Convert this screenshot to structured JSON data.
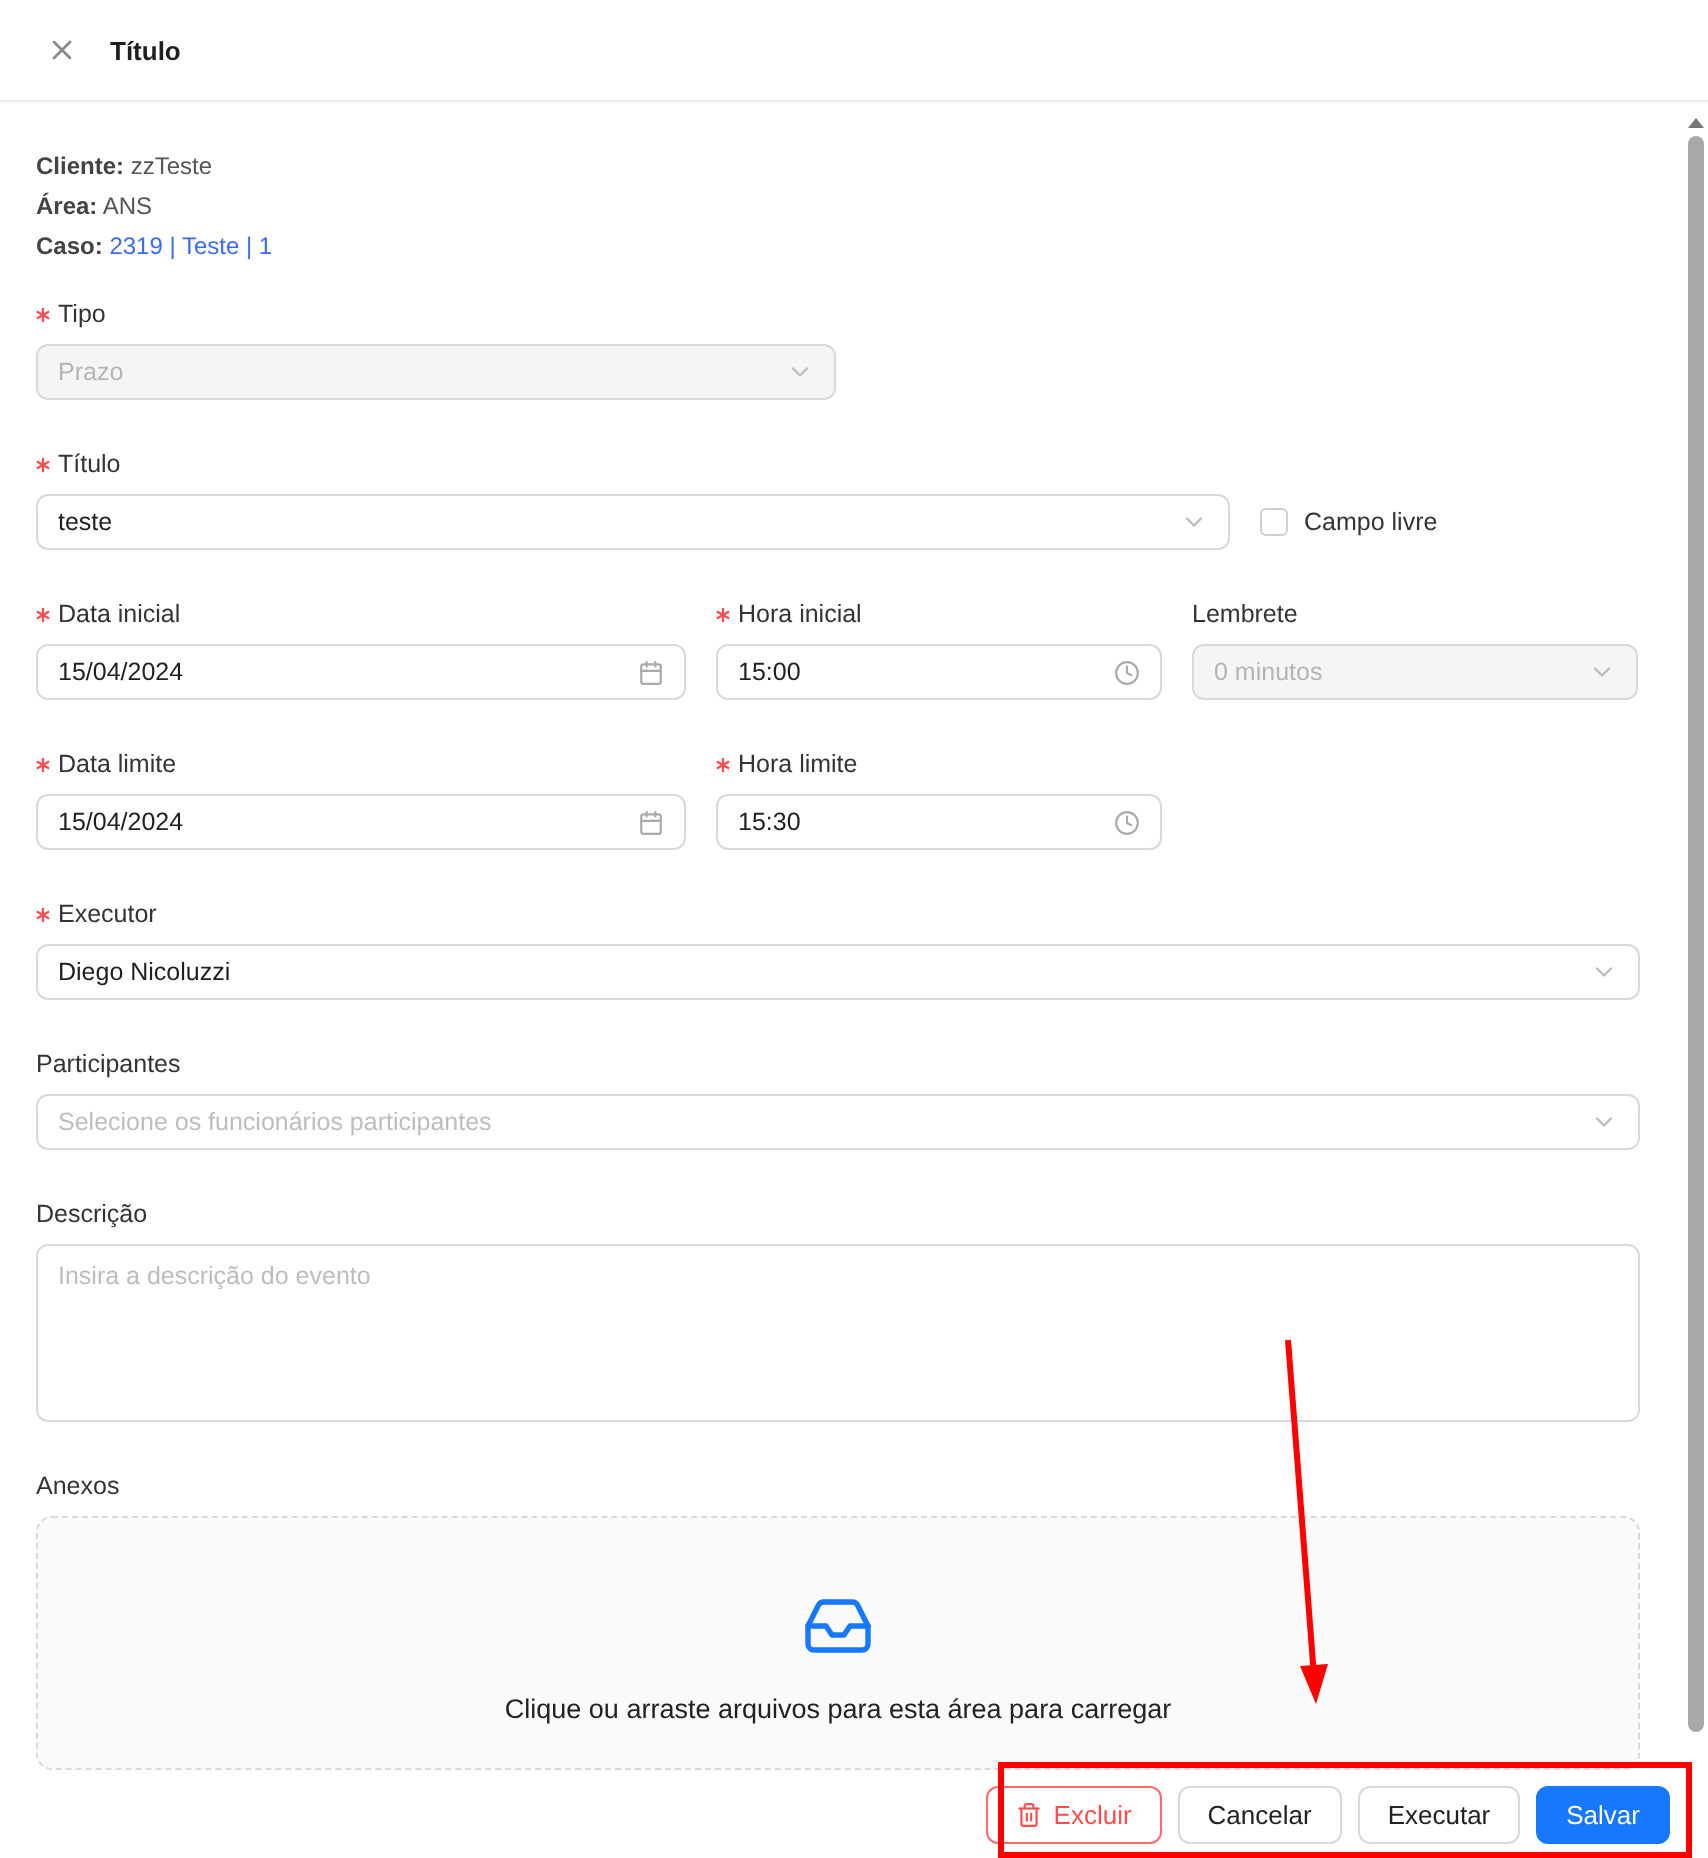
{
  "header": {
    "title": "Título"
  },
  "info": [
    {
      "label": "Cliente:",
      "value": "zzTeste",
      "kind": "text"
    },
    {
      "label": "Área:",
      "value": "ANS",
      "kind": "text"
    },
    {
      "label": "Caso:",
      "value": "2319 | Teste | 1",
      "kind": "link"
    }
  ],
  "tipo": {
    "label": "Tipo",
    "required": true,
    "value": "Prazo",
    "disabled": true
  },
  "titulo": {
    "label": "Título",
    "required": true,
    "value": "teste"
  },
  "campo_livre": {
    "label": "Campo livre",
    "checked": false
  },
  "data_inicial": {
    "label": "Data inicial",
    "required": true,
    "value": "15/04/2024"
  },
  "hora_inicial": {
    "label": "Hora inicial",
    "required": true,
    "value": "15:00"
  },
  "lembrete": {
    "label": "Lembrete",
    "required": false,
    "value": "0 minutos",
    "disabled": true
  },
  "data_limite": {
    "label": "Data limite",
    "required": true,
    "value": "15/04/2024"
  },
  "hora_limite": {
    "label": "Hora limite",
    "required": true,
    "value": "15:30"
  },
  "executor": {
    "label": "Executor",
    "required": true,
    "value": "Diego Nicoluzzi"
  },
  "participantes": {
    "label": "Participantes",
    "required": false,
    "placeholder": "Selecione os funcionários participantes"
  },
  "descricao": {
    "label": "Descrição",
    "required": false,
    "placeholder": "Insira a descrição do evento"
  },
  "anexos": {
    "label": "Anexos",
    "text": "Clique ou arraste arquivos para esta área para carregar"
  },
  "buttons": [
    {
      "label": "Excluir",
      "kind": "danger"
    },
    {
      "label": "Cancelar",
      "kind": "default"
    },
    {
      "label": "Executar",
      "kind": "default"
    },
    {
      "label": "Salvar",
      "kind": "primary"
    }
  ]
}
